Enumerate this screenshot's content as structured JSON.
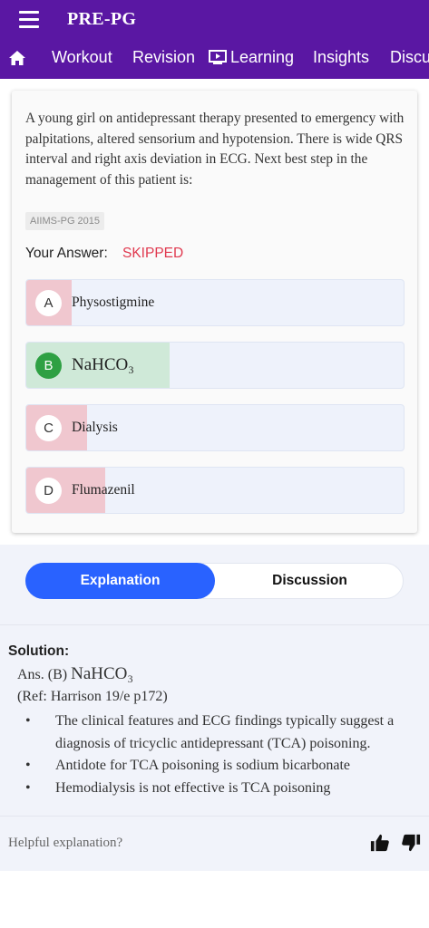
{
  "app": {
    "title": "PRE-PG"
  },
  "icons": {
    "menu": "hamburger-menu-icon",
    "home": "home-icon",
    "learning": "play-screen-icon",
    "like": "thumbs-up-icon",
    "dislike": "thumbs-down-icon"
  },
  "colors": {
    "header": "#5a17a3",
    "accent": "#2962ff",
    "correct": "#2ea043",
    "skipped": "#e0394f",
    "wrong_fill": "#f0c7cf",
    "correct_fill": "#cfe9d8"
  },
  "nav": {
    "tabs": [
      {
        "label": "Workout"
      },
      {
        "label": "Revision"
      },
      {
        "label": "Learning"
      },
      {
        "label": "Insights"
      },
      {
        "label": "Discu"
      }
    ]
  },
  "question": {
    "text": "A young girl on antidepressant therapy presented to emergency with palpitations, altered sensorium and hypotension. There is wide QRS interval and right axis deviation in ECG. Next best step in the management of this patient is:",
    "tag": "AIIMS-PG 2015",
    "your_answer_label": "Your Answer:",
    "your_answer_value": "SKIPPED",
    "options": [
      {
        "letter": "A",
        "text": "Physostigmine",
        "percent": 12,
        "correct": false
      },
      {
        "letter": "B",
        "text": "NaHCO₃",
        "percent": 38,
        "correct": true
      },
      {
        "letter": "C",
        "text": "Dialysis",
        "percent": 16,
        "correct": false
      },
      {
        "letter": "D",
        "text": "Flumazenil",
        "percent": 21,
        "correct": false
      }
    ]
  },
  "segment": {
    "explanation": "Explanation",
    "discussion": "Discussion",
    "active": "Explanation"
  },
  "solution": {
    "title": "Solution:",
    "answer_prefix": "Ans. (B) ",
    "answer_value": "NaHCO₃",
    "reference": "(Ref: Harrison 19/e p172)",
    "bullets": [
      "The clinical features and ECG findings typically suggest a diagnosis of tricyclic antidepressant (TCA) poisoning.",
      "Antidote for TCA poisoning is sodium bicarbonate",
      "Hemodialysis is not effective is TCA poisoning"
    ]
  },
  "feedback": {
    "prompt": "Helpful explanation?"
  }
}
